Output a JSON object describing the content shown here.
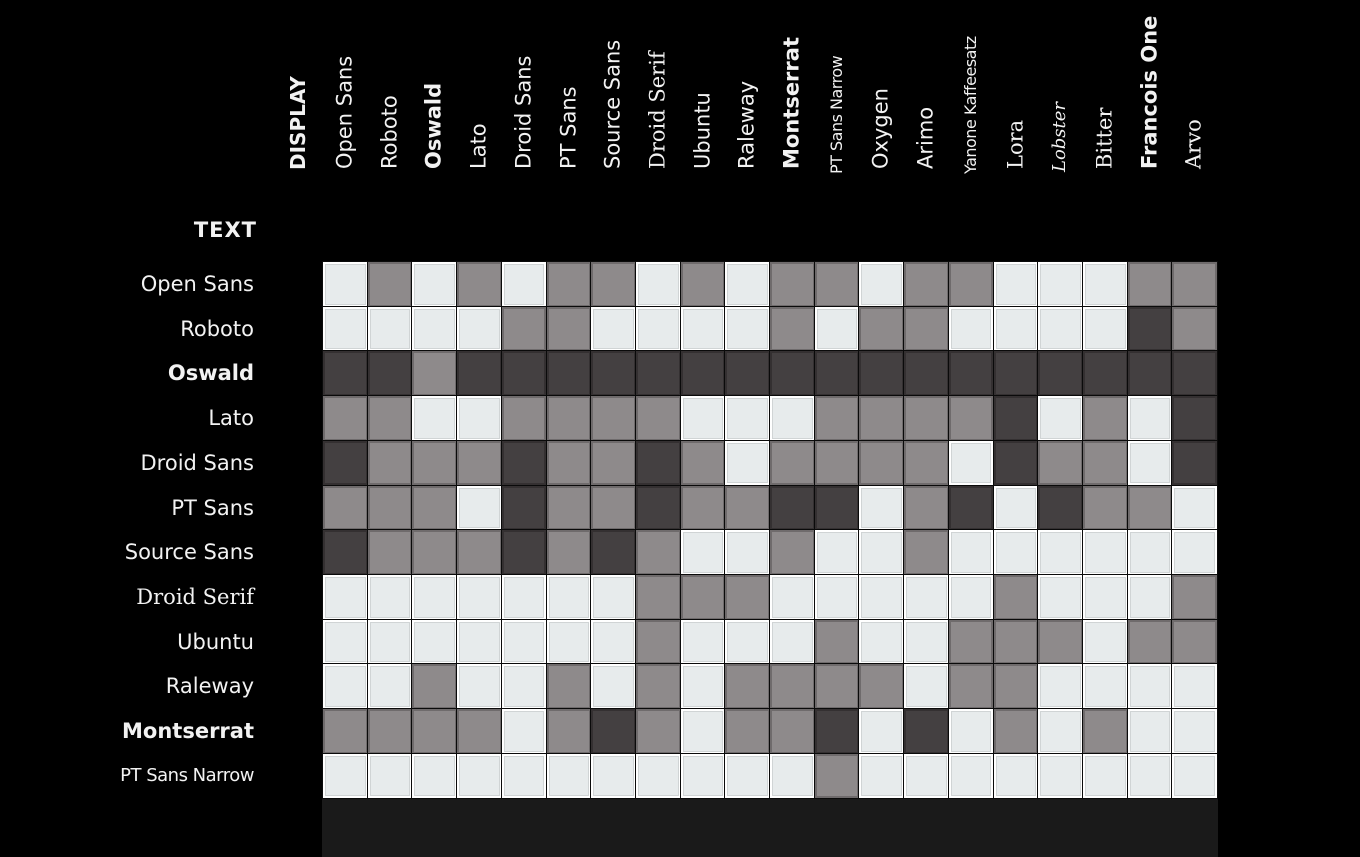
{
  "chart_data": {
    "type": "heatmap",
    "title": "",
    "xlabel": "DISPLAY",
    "ylabel": "TEXT",
    "legend": "none",
    "x_categories": [
      "Open Sans",
      "Roboto",
      "Oswald",
      "Lato",
      "Droid Sans",
      "PT Sans",
      "Source Sans",
      "Droid Serif",
      "Ubuntu",
      "Raleway",
      "Montserrat",
      "PT Sans Narrow",
      "Oxygen",
      "Arimo",
      "Yanone Kaffeesatz",
      "Lora",
      "Lobster",
      "Bitter",
      "Francois One",
      "Arvo"
    ],
    "y_categories": [
      "Open Sans",
      "Roboto",
      "Oswald",
      "Lato",
      "Droid Sans",
      "PT Sans",
      "Source Sans",
      "Droid Serif",
      "Ubuntu",
      "Raleway",
      "Montserrat",
      "PT Sans Narrow"
    ],
    "value_scale": {
      "L": "light",
      "M": "medium",
      "D": "dark"
    },
    "levels": {
      "light": 2,
      "medium": 1,
      "dark": 0
    },
    "colors": {
      "light": "#e7ebec",
      "medium": "#8e8a8b",
      "dark": "#444041",
      "background": "#000000",
      "text": "#f2f2f2"
    },
    "matrix": [
      [
        "L",
        "M",
        "L",
        "M",
        "L",
        "M",
        "M",
        "L",
        "M",
        "L",
        "M",
        "M",
        "L",
        "M",
        "M",
        "L",
        "L",
        "L",
        "M",
        "M"
      ],
      [
        "L",
        "L",
        "L",
        "L",
        "M",
        "M",
        "L",
        "L",
        "L",
        "L",
        "M",
        "L",
        "M",
        "M",
        "L",
        "L",
        "L",
        "L",
        "D",
        "M"
      ],
      [
        "D",
        "D",
        "M",
        "D",
        "D",
        "D",
        "D",
        "D",
        "D",
        "D",
        "D",
        "D",
        "D",
        "D",
        "D",
        "D",
        "D",
        "D",
        "D",
        "D"
      ],
      [
        "M",
        "M",
        "L",
        "L",
        "M",
        "M",
        "M",
        "M",
        "L",
        "L",
        "L",
        "M",
        "M",
        "M",
        "M",
        "D",
        "L",
        "M",
        "L",
        "D"
      ],
      [
        "D",
        "M",
        "M",
        "M",
        "D",
        "M",
        "M",
        "D",
        "M",
        "L",
        "M",
        "M",
        "M",
        "M",
        "L",
        "D",
        "M",
        "M",
        "L",
        "D"
      ],
      [
        "M",
        "M",
        "M",
        "L",
        "D",
        "M",
        "M",
        "D",
        "M",
        "M",
        "D",
        "D",
        "L",
        "M",
        "D",
        "L",
        "D",
        "M",
        "M",
        "L"
      ],
      [
        "D",
        "M",
        "M",
        "M",
        "D",
        "M",
        "D",
        "M",
        "L",
        "L",
        "M",
        "L",
        "L",
        "M",
        "L",
        "L",
        "L",
        "L",
        "L",
        "L"
      ],
      [
        "L",
        "L",
        "L",
        "L",
        "L",
        "L",
        "L",
        "M",
        "M",
        "M",
        "L",
        "L",
        "L",
        "L",
        "L",
        "M",
        "L",
        "L",
        "L",
        "M"
      ],
      [
        "L",
        "L",
        "L",
        "L",
        "L",
        "L",
        "L",
        "M",
        "L",
        "L",
        "L",
        "M",
        "L",
        "L",
        "M",
        "M",
        "M",
        "L",
        "M",
        "M"
      ],
      [
        "L",
        "L",
        "M",
        "L",
        "L",
        "M",
        "L",
        "M",
        "L",
        "M",
        "M",
        "M",
        "M",
        "L",
        "M",
        "M",
        "L",
        "L",
        "L",
        "L"
      ],
      [
        "M",
        "M",
        "M",
        "M",
        "L",
        "M",
        "D",
        "M",
        "L",
        "M",
        "M",
        "D",
        "L",
        "D",
        "L",
        "M",
        "L",
        "M",
        "L",
        "L"
      ],
      [
        "L",
        "L",
        "L",
        "L",
        "L",
        "L",
        "L",
        "L",
        "L",
        "L",
        "L",
        "M",
        "L",
        "L",
        "L",
        "L",
        "L",
        "L",
        "L",
        "L"
      ]
    ]
  },
  "labels": {
    "display_title": "DISPLAY",
    "text_title": "TEXT"
  }
}
